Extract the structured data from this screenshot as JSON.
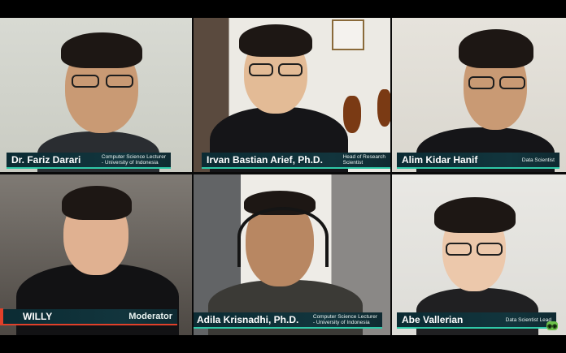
{
  "participants": [
    {
      "name": "Dr. Fariz Darari",
      "role_line1": "Computer Science Lecturer",
      "role_line2": "- University of Indonesia"
    },
    {
      "name": "Irvan Bastian Arief, Ph.D.",
      "role_line1": "Head of Research",
      "role_line2": "Scientist"
    },
    {
      "name": "Alim Kidar Hanif",
      "role_line1": "Data Scientist",
      "role_line2": ""
    },
    {
      "name": "WILLY",
      "role_line1": "Moderator",
      "role_line2": ""
    },
    {
      "name": "Adila Krisnadhi, Ph.D.",
      "role_line1": "Computer Science Lecturer",
      "role_line2": "- University of Indonesia"
    },
    {
      "name": "Abe Vallerian",
      "role_line1": "Data Scientist Lead",
      "role_line2": ""
    }
  ],
  "colors": {
    "accent": "#2fc9a8",
    "plate": "#0b2b33"
  },
  "logo_icon": "owl-logo-icon"
}
